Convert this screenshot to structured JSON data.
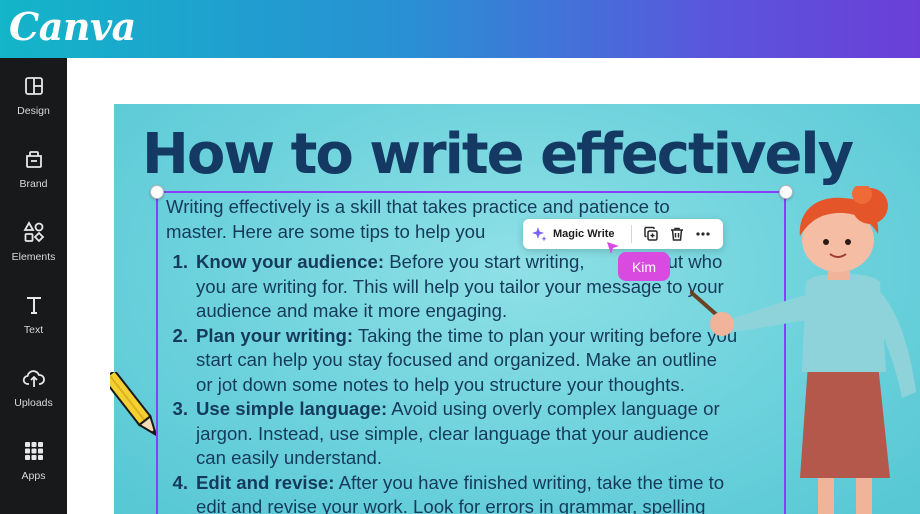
{
  "app": {
    "logo": "Canva"
  },
  "sidebar": {
    "items": [
      {
        "label": "Design",
        "icon": "layout-icon"
      },
      {
        "label": "Brand",
        "icon": "brand-kit-icon"
      },
      {
        "label": "Elements",
        "icon": "shapes-icon"
      },
      {
        "label": "Text",
        "icon": "text-icon"
      },
      {
        "label": "Uploads",
        "icon": "cloud-upload-icon"
      },
      {
        "label": "Apps",
        "icon": "grid-icon"
      }
    ]
  },
  "design": {
    "heading": "How to write effectively",
    "intro": [
      "Writing effectively is a skill that takes practice and patience to",
      "master. Here are some tips to help you"
    ],
    "tips": [
      {
        "number": "1.",
        "title": "Know your audience:",
        "first_line": " Before you start writing,",
        "first_line_tail": "about who",
        "lines": [
          "you are writing for. This will help you tailor your message to your",
          "audience and make it more engaging."
        ]
      },
      {
        "number": "2.",
        "title": "Plan your writing:",
        "first_line": " Taking the time to plan your writing before you",
        "lines": [
          "start can help you stay focused and organized. Make an outline",
          "or jot down some notes to help you structure your thoughts."
        ]
      },
      {
        "number": "3.",
        "title": "Use simple language:",
        "first_line": " Avoid using overly complex language or",
        "lines": [
          "jargon. Instead, use simple, clear language that your audience",
          "can easily understand."
        ]
      },
      {
        "number": "4.",
        "title": "Edit and revise:",
        "first_line": " After you have finished writing, take the time to",
        "lines": [
          "edit and revise your work. Look for errors in grammar, spelling"
        ]
      }
    ]
  },
  "toolbar": {
    "magic_write_label": "Magic Write",
    "icons": [
      "sparkle-icon",
      "duplicate-icon",
      "trash-icon",
      "more-icon"
    ]
  },
  "collaborator": {
    "name": "Kim"
  },
  "colors": {
    "header_gradient_start": "#13b5c8",
    "header_gradient_end": "#6a3fd8",
    "sidebar_bg": "#18191b",
    "canvas_bg": "#6dd2dc",
    "heading_color": "#143a63",
    "selection_color": "#8b3dff",
    "collaborator_color": "#d94be0"
  }
}
